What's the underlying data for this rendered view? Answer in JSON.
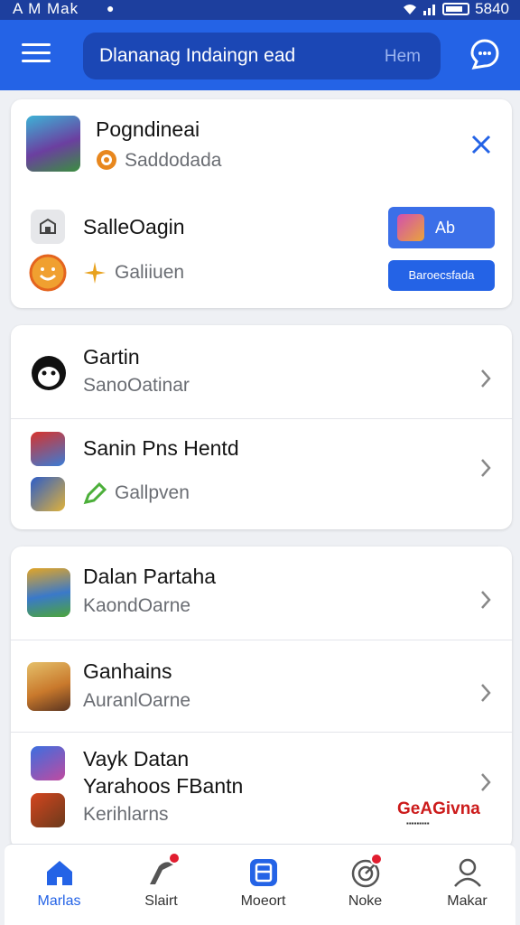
{
  "status_bar": {
    "time": "A M Mak",
    "battery": "5840"
  },
  "colors": {
    "primary": "#2463e6",
    "status_bar": "#1d3f9e",
    "search_bg": "#1b47b5",
    "watermark": "#cc1b1b",
    "badge": "#e11d2f"
  },
  "app_bar": {
    "menu_icon": "hamburger-menu-icon",
    "search": {
      "query": "Dlananag Indaingn ead",
      "hint": "Hem"
    },
    "chat_icon": "chat-bubble-icon"
  },
  "card1": {
    "header": {
      "title": "Pogndineai",
      "subtitle": "Saddodada",
      "close_icon": "close-icon"
    },
    "row": {
      "title": "SalleOagin",
      "subtitle": "Galiiuen",
      "promo_label": "Ab",
      "promo_button": "Baroecsfada"
    }
  },
  "card2": {
    "items": [
      {
        "title": "Gartin",
        "subtitle": "SanoOatinar"
      },
      {
        "title": "Sanin Pns Hentd",
        "subtitle": "Gallpven"
      }
    ]
  },
  "card3": {
    "items": [
      {
        "title": "Dalan Partaha",
        "subtitle": "KaondOarne"
      },
      {
        "title": "Ganhains",
        "subtitle": "AuranlOarne"
      },
      {
        "title": "Vayk Datan",
        "title2": "Yarahoos FBantn",
        "subtitle": "Kerihlarns"
      }
    ],
    "watermark": "GeAGivna"
  },
  "bottom_nav": [
    {
      "label": "Marlas",
      "icon": "home-icon",
      "active": true
    },
    {
      "label": "Slairt",
      "icon": "tools-icon",
      "active": false
    },
    {
      "label": "Moeort",
      "icon": "gamepad-icon",
      "active": false
    },
    {
      "label": "Noke",
      "icon": "target-icon",
      "active": false
    },
    {
      "label": "Makar",
      "icon": "user-icon",
      "active": false
    }
  ]
}
